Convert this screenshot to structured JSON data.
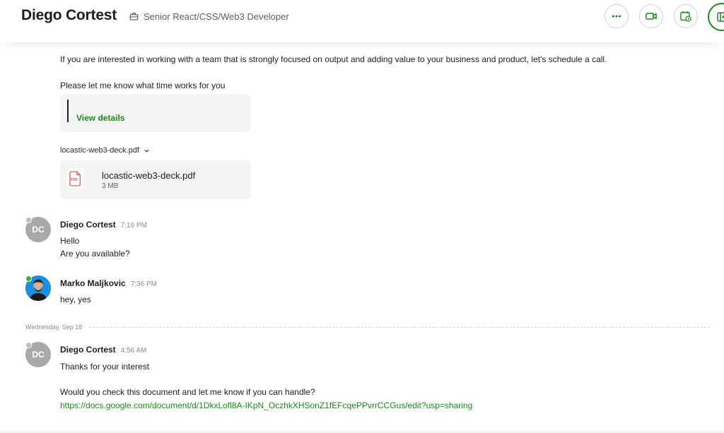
{
  "header": {
    "title": "Diego Cortest",
    "subtitle": "Senior React/CSS/Web3 Developer",
    "icons": [
      "briefcase-icon",
      "more-icon",
      "video-icon",
      "schedule-icon",
      "panel-toggle-icon"
    ],
    "accent": "#1a8a1a"
  },
  "thread": {
    "intro_line": "If you are interested in working with a team that is strongly focused on output and adding value to your business and product, let's schedule a call.",
    "time_line": "Please let me know what time works for you",
    "view_details": "View details",
    "attachment_label": "locastic-web3-deck.pdf",
    "attachment": {
      "name": "locastic-web3-deck.pdf",
      "size": "3 MB",
      "badge": "PDF"
    },
    "messages": [
      {
        "avatar": "DC",
        "sender": "Diego Cortest",
        "time": "7:16 PM",
        "lines": [
          "Hello",
          "Are you available?"
        ]
      },
      {
        "sender": "Marko Maljkovic",
        "time": "7:36 PM",
        "lines": [
          "hey, yes"
        ]
      }
    ],
    "date_separator": "Wednesday, Sep 18",
    "last_message": {
      "avatar": "DC",
      "sender": "Diego Cortest",
      "time": "4:56 AM",
      "line1": "Thanks for your interest",
      "line2": "Would you check this document and let me know if you can handle?",
      "url": "https://docs.google.com/document/d/1DkxLofl8A-IKpN_OczhkXHSonZ1fEFcqePPvrrCCGus/edit?usp=sharing"
    }
  }
}
